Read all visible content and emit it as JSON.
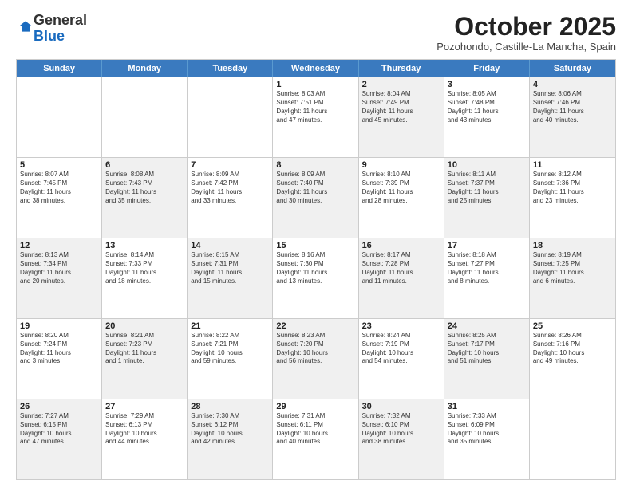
{
  "header": {
    "logo_line1": "General",
    "logo_line2": "Blue",
    "month_title": "October 2025",
    "location": "Pozohondo, Castille-La Mancha, Spain"
  },
  "days_of_week": [
    "Sunday",
    "Monday",
    "Tuesday",
    "Wednesday",
    "Thursday",
    "Friday",
    "Saturday"
  ],
  "rows": [
    [
      {
        "day": "",
        "info": "",
        "shaded": false
      },
      {
        "day": "",
        "info": "",
        "shaded": false
      },
      {
        "day": "",
        "info": "",
        "shaded": false
      },
      {
        "day": "1",
        "info": "Sunrise: 8:03 AM\nSunset: 7:51 PM\nDaylight: 11 hours\nand 47 minutes.",
        "shaded": false
      },
      {
        "day": "2",
        "info": "Sunrise: 8:04 AM\nSunset: 7:49 PM\nDaylight: 11 hours\nand 45 minutes.",
        "shaded": true
      },
      {
        "day": "3",
        "info": "Sunrise: 8:05 AM\nSunset: 7:48 PM\nDaylight: 11 hours\nand 43 minutes.",
        "shaded": false
      },
      {
        "day": "4",
        "info": "Sunrise: 8:06 AM\nSunset: 7:46 PM\nDaylight: 11 hours\nand 40 minutes.",
        "shaded": true
      }
    ],
    [
      {
        "day": "5",
        "info": "Sunrise: 8:07 AM\nSunset: 7:45 PM\nDaylight: 11 hours\nand 38 minutes.",
        "shaded": false
      },
      {
        "day": "6",
        "info": "Sunrise: 8:08 AM\nSunset: 7:43 PM\nDaylight: 11 hours\nand 35 minutes.",
        "shaded": true
      },
      {
        "day": "7",
        "info": "Sunrise: 8:09 AM\nSunset: 7:42 PM\nDaylight: 11 hours\nand 33 minutes.",
        "shaded": false
      },
      {
        "day": "8",
        "info": "Sunrise: 8:09 AM\nSunset: 7:40 PM\nDaylight: 11 hours\nand 30 minutes.",
        "shaded": true
      },
      {
        "day": "9",
        "info": "Sunrise: 8:10 AM\nSunset: 7:39 PM\nDaylight: 11 hours\nand 28 minutes.",
        "shaded": false
      },
      {
        "day": "10",
        "info": "Sunrise: 8:11 AM\nSunset: 7:37 PM\nDaylight: 11 hours\nand 25 minutes.",
        "shaded": true
      },
      {
        "day": "11",
        "info": "Sunrise: 8:12 AM\nSunset: 7:36 PM\nDaylight: 11 hours\nand 23 minutes.",
        "shaded": false
      }
    ],
    [
      {
        "day": "12",
        "info": "Sunrise: 8:13 AM\nSunset: 7:34 PM\nDaylight: 11 hours\nand 20 minutes.",
        "shaded": true
      },
      {
        "day": "13",
        "info": "Sunrise: 8:14 AM\nSunset: 7:33 PM\nDaylight: 11 hours\nand 18 minutes.",
        "shaded": false
      },
      {
        "day": "14",
        "info": "Sunrise: 8:15 AM\nSunset: 7:31 PM\nDaylight: 11 hours\nand 15 minutes.",
        "shaded": true
      },
      {
        "day": "15",
        "info": "Sunrise: 8:16 AM\nSunset: 7:30 PM\nDaylight: 11 hours\nand 13 minutes.",
        "shaded": false
      },
      {
        "day": "16",
        "info": "Sunrise: 8:17 AM\nSunset: 7:28 PM\nDaylight: 11 hours\nand 11 minutes.",
        "shaded": true
      },
      {
        "day": "17",
        "info": "Sunrise: 8:18 AM\nSunset: 7:27 PM\nDaylight: 11 hours\nand 8 minutes.",
        "shaded": false
      },
      {
        "day": "18",
        "info": "Sunrise: 8:19 AM\nSunset: 7:25 PM\nDaylight: 11 hours\nand 6 minutes.",
        "shaded": true
      }
    ],
    [
      {
        "day": "19",
        "info": "Sunrise: 8:20 AM\nSunset: 7:24 PM\nDaylight: 11 hours\nand 3 minutes.",
        "shaded": false
      },
      {
        "day": "20",
        "info": "Sunrise: 8:21 AM\nSunset: 7:23 PM\nDaylight: 11 hours\nand 1 minute.",
        "shaded": true
      },
      {
        "day": "21",
        "info": "Sunrise: 8:22 AM\nSunset: 7:21 PM\nDaylight: 10 hours\nand 59 minutes.",
        "shaded": false
      },
      {
        "day": "22",
        "info": "Sunrise: 8:23 AM\nSunset: 7:20 PM\nDaylight: 10 hours\nand 56 minutes.",
        "shaded": true
      },
      {
        "day": "23",
        "info": "Sunrise: 8:24 AM\nSunset: 7:19 PM\nDaylight: 10 hours\nand 54 minutes.",
        "shaded": false
      },
      {
        "day": "24",
        "info": "Sunrise: 8:25 AM\nSunset: 7:17 PM\nDaylight: 10 hours\nand 51 minutes.",
        "shaded": true
      },
      {
        "day": "25",
        "info": "Sunrise: 8:26 AM\nSunset: 7:16 PM\nDaylight: 10 hours\nand 49 minutes.",
        "shaded": false
      }
    ],
    [
      {
        "day": "26",
        "info": "Sunrise: 7:27 AM\nSunset: 6:15 PM\nDaylight: 10 hours\nand 47 minutes.",
        "shaded": true
      },
      {
        "day": "27",
        "info": "Sunrise: 7:29 AM\nSunset: 6:13 PM\nDaylight: 10 hours\nand 44 minutes.",
        "shaded": false
      },
      {
        "day": "28",
        "info": "Sunrise: 7:30 AM\nSunset: 6:12 PM\nDaylight: 10 hours\nand 42 minutes.",
        "shaded": true
      },
      {
        "day": "29",
        "info": "Sunrise: 7:31 AM\nSunset: 6:11 PM\nDaylight: 10 hours\nand 40 minutes.",
        "shaded": false
      },
      {
        "day": "30",
        "info": "Sunrise: 7:32 AM\nSunset: 6:10 PM\nDaylight: 10 hours\nand 38 minutes.",
        "shaded": true
      },
      {
        "day": "31",
        "info": "Sunrise: 7:33 AM\nSunset: 6:09 PM\nDaylight: 10 hours\nand 35 minutes.",
        "shaded": false
      },
      {
        "day": "",
        "info": "",
        "shaded": false
      }
    ]
  ]
}
